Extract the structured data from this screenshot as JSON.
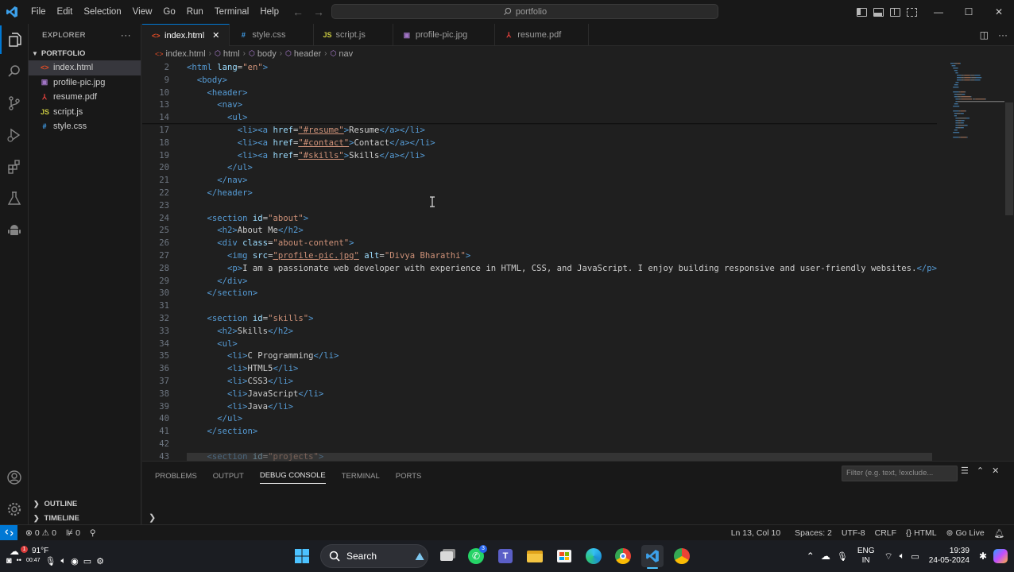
{
  "titlebar": {
    "menu": [
      "File",
      "Edit",
      "Selection",
      "View",
      "Go",
      "Run",
      "Terminal",
      "Help"
    ],
    "search_text": "portfolio"
  },
  "sidebar": {
    "title": "EXPLORER",
    "folder": "PORTFOLIO",
    "files": [
      {
        "name": "index.html",
        "icon": "html-file-icon",
        "icon_glyph": "<>",
        "icon_color": "#e44d26",
        "selected": true
      },
      {
        "name": "profile-pic.jpg",
        "icon": "image-file-icon",
        "icon_glyph": "▣",
        "icon_color": "#a074c4",
        "selected": false
      },
      {
        "name": "resume.pdf",
        "icon": "pdf-file-icon",
        "icon_glyph": "⅄",
        "icon_color": "#e5413c",
        "selected": false
      },
      {
        "name": "script.js",
        "icon": "js-file-icon",
        "icon_glyph": "JS",
        "icon_color": "#cbcb41",
        "selected": false
      },
      {
        "name": "style.css",
        "icon": "css-file-icon",
        "icon_glyph": "#",
        "icon_color": "#42a5f5",
        "selected": false
      }
    ],
    "outline": "OUTLINE",
    "timeline": "TIMELINE"
  },
  "tabs": [
    {
      "label": "index.html",
      "icon": "html-file-icon",
      "glyph": "<>",
      "color": "#e44d26",
      "active": true
    },
    {
      "label": "style.css",
      "icon": "css-file-icon",
      "glyph": "#",
      "color": "#42a5f5",
      "active": false
    },
    {
      "label": "script.js",
      "icon": "js-file-icon",
      "glyph": "JS",
      "color": "#cbcb41",
      "active": false
    },
    {
      "label": "profile-pic.jpg",
      "icon": "image-file-icon",
      "glyph": "▣",
      "color": "#a074c4",
      "active": false
    },
    {
      "label": "resume.pdf",
      "icon": "pdf-file-icon",
      "glyph": "⅄",
      "color": "#e5413c",
      "active": false
    }
  ],
  "breadcrumb": [
    "index.html",
    "html",
    "body",
    "header",
    "nav"
  ],
  "code": [
    {
      "n": "2",
      "toks": [
        [
          "tag",
          "<html "
        ],
        [
          "attr",
          "lang"
        ],
        [
          "text",
          "="
        ],
        [
          "str",
          "\"en\""
        ],
        [
          "tag",
          ">"
        ]
      ]
    },
    {
      "n": "9",
      "toks": [
        [
          "text",
          "  "
        ],
        [
          "tag",
          "<body>"
        ]
      ]
    },
    {
      "n": "10",
      "toks": [
        [
          "text",
          "    "
        ],
        [
          "tag",
          "<header>"
        ]
      ]
    },
    {
      "n": "13",
      "toks": [
        [
          "text",
          "      "
        ],
        [
          "tag",
          "<nav>"
        ]
      ]
    },
    {
      "n": "14",
      "toks": [
        [
          "text",
          "        "
        ],
        [
          "tag",
          "<ul>"
        ]
      ]
    },
    {
      "n": "17",
      "toks": [
        [
          "text",
          "          "
        ],
        [
          "tag",
          "<li><a "
        ],
        [
          "attr",
          "href"
        ],
        [
          "text",
          "="
        ],
        [
          "str",
          "\"#resume\""
        ],
        [
          "tag",
          ">"
        ],
        [
          "text",
          "Resume"
        ],
        [
          "tag",
          "</a></li>"
        ]
      ]
    },
    {
      "n": "18",
      "toks": [
        [
          "text",
          "          "
        ],
        [
          "tag",
          "<li><a "
        ],
        [
          "attr",
          "href"
        ],
        [
          "text",
          "="
        ],
        [
          "str",
          "\"#contact\""
        ],
        [
          "tag",
          ">"
        ],
        [
          "text",
          "Contact"
        ],
        [
          "tag",
          "</a></li>"
        ]
      ]
    },
    {
      "n": "19",
      "toks": [
        [
          "text",
          "          "
        ],
        [
          "tag",
          "<li><a "
        ],
        [
          "attr",
          "href"
        ],
        [
          "text",
          "="
        ],
        [
          "str",
          "\"#skills\""
        ],
        [
          "tag",
          ">"
        ],
        [
          "text",
          "Skills"
        ],
        [
          "tag",
          "</a></li>"
        ]
      ]
    },
    {
      "n": "20",
      "toks": [
        [
          "text",
          "        "
        ],
        [
          "tag",
          "</ul>"
        ]
      ]
    },
    {
      "n": "21",
      "toks": [
        [
          "text",
          "      "
        ],
        [
          "tag",
          "</nav>"
        ]
      ]
    },
    {
      "n": "22",
      "toks": [
        [
          "text",
          "    "
        ],
        [
          "tag",
          "</header>"
        ]
      ]
    },
    {
      "n": "23",
      "toks": []
    },
    {
      "n": "24",
      "toks": [
        [
          "text",
          "    "
        ],
        [
          "tag",
          "<section "
        ],
        [
          "attr",
          "id"
        ],
        [
          "text",
          "="
        ],
        [
          "str",
          "\"about\""
        ],
        [
          "tag",
          ">"
        ]
      ]
    },
    {
      "n": "25",
      "toks": [
        [
          "text",
          "      "
        ],
        [
          "tag",
          "<h2>"
        ],
        [
          "text",
          "About Me"
        ],
        [
          "tag",
          "</h2>"
        ]
      ]
    },
    {
      "n": "26",
      "toks": [
        [
          "text",
          "      "
        ],
        [
          "tag",
          "<div "
        ],
        [
          "attr",
          "class"
        ],
        [
          "text",
          "="
        ],
        [
          "str",
          "\"about-content\""
        ],
        [
          "tag",
          ">"
        ]
      ]
    },
    {
      "n": "27",
      "toks": [
        [
          "text",
          "        "
        ],
        [
          "tag",
          "<img "
        ],
        [
          "attr",
          "src"
        ],
        [
          "text",
          "="
        ],
        [
          "str",
          "\"profile-pic.jpg\""
        ],
        [
          "text",
          " "
        ],
        [
          "attr",
          "alt"
        ],
        [
          "text",
          "="
        ],
        [
          "str",
          "\"Divya Bharathi\""
        ],
        [
          "tag",
          ">"
        ]
      ]
    },
    {
      "n": "28",
      "toks": [
        [
          "text",
          "        "
        ],
        [
          "tag",
          "<p>"
        ],
        [
          "text",
          "I am a passionate web developer with experience in HTML, CSS, and JavaScript. I enjoy building responsive and user-friendly websites."
        ],
        [
          "tag",
          "</p>"
        ]
      ]
    },
    {
      "n": "29",
      "toks": [
        [
          "text",
          "      "
        ],
        [
          "tag",
          "</div>"
        ]
      ]
    },
    {
      "n": "30",
      "toks": [
        [
          "text",
          "    "
        ],
        [
          "tag",
          "</section>"
        ]
      ]
    },
    {
      "n": "31",
      "toks": []
    },
    {
      "n": "32",
      "toks": [
        [
          "text",
          "    "
        ],
        [
          "tag",
          "<section "
        ],
        [
          "attr",
          "id"
        ],
        [
          "text",
          "="
        ],
        [
          "str",
          "\"skills\""
        ],
        [
          "tag",
          ">"
        ]
      ]
    },
    {
      "n": "33",
      "toks": [
        [
          "text",
          "      "
        ],
        [
          "tag",
          "<h2>"
        ],
        [
          "text",
          "Skills"
        ],
        [
          "tag",
          "</h2>"
        ]
      ]
    },
    {
      "n": "34",
      "toks": [
        [
          "text",
          "      "
        ],
        [
          "tag",
          "<ul>"
        ]
      ]
    },
    {
      "n": "35",
      "toks": [
        [
          "text",
          "        "
        ],
        [
          "tag",
          "<li>"
        ],
        [
          "text",
          "C Programming"
        ],
        [
          "tag",
          "</li>"
        ]
      ]
    },
    {
      "n": "36",
      "toks": [
        [
          "text",
          "        "
        ],
        [
          "tag",
          "<li>"
        ],
        [
          "text",
          "HTML5"
        ],
        [
          "tag",
          "</li>"
        ]
      ]
    },
    {
      "n": "37",
      "toks": [
        [
          "text",
          "        "
        ],
        [
          "tag",
          "<li>"
        ],
        [
          "text",
          "CSS3"
        ],
        [
          "tag",
          "</li>"
        ]
      ]
    },
    {
      "n": "38",
      "toks": [
        [
          "text",
          "        "
        ],
        [
          "tag",
          "<li>"
        ],
        [
          "text",
          "JavaScript"
        ],
        [
          "tag",
          "</li>"
        ]
      ]
    },
    {
      "n": "39",
      "toks": [
        [
          "text",
          "        "
        ],
        [
          "tag",
          "<li>"
        ],
        [
          "text",
          "Java"
        ],
        [
          "tag",
          "</li>"
        ]
      ]
    },
    {
      "n": "40",
      "toks": [
        [
          "text",
          "      "
        ],
        [
          "tag",
          "</ul>"
        ]
      ]
    },
    {
      "n": "41",
      "toks": [
        [
          "text",
          "    "
        ],
        [
          "tag",
          "</section>"
        ]
      ]
    },
    {
      "n": "42",
      "toks": []
    },
    {
      "n": "43",
      "toks": [
        [
          "text",
          "    "
        ],
        [
          "tag",
          "<section "
        ],
        [
          "attr",
          "id"
        ],
        [
          "text",
          "="
        ],
        [
          "str",
          "\"projects\""
        ],
        [
          "tag",
          ">"
        ]
      ]
    }
  ],
  "panel": {
    "tabs": [
      "PROBLEMS",
      "OUTPUT",
      "DEBUG CONSOLE",
      "TERMINAL",
      "PORTS"
    ],
    "active_tab": "DEBUG CONSOLE",
    "filter_placeholder": "Filter (e.g. text, !exclude..."
  },
  "status": {
    "errors": "0",
    "warnings": "0",
    "ports": "0",
    "position": "Ln 13, Col 10",
    "spaces": "Spaces: 2",
    "encoding": "UTF-8",
    "eol": "CRLF",
    "language": "HTML",
    "golive": "Go Live"
  },
  "taskbar": {
    "temperature": "91°F",
    "weather_badge": "1",
    "recording_time": "00:47",
    "search_label": "Search",
    "lang_line1": "ENG",
    "lang_line2": "IN",
    "time": "19:39",
    "date": "24-05-2024",
    "whatsapp_badge": "3"
  }
}
